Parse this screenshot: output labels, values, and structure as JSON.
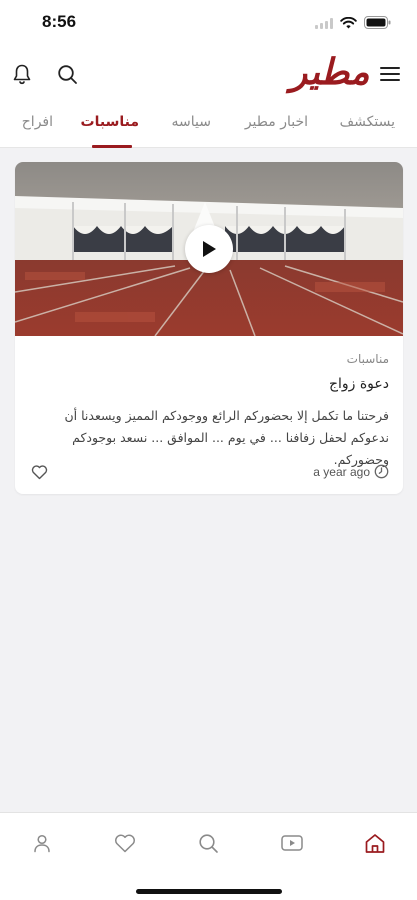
{
  "status_bar": {
    "time": "8:56"
  },
  "header": {
    "logo": "مطير"
  },
  "tabs": [
    {
      "label": "يستكشف",
      "active": false
    },
    {
      "label": "اخبار مطير",
      "active": false
    },
    {
      "label": "سياسه",
      "active": false
    },
    {
      "label": "مناسبات",
      "active": true
    },
    {
      "label": "افراح",
      "active": false
    }
  ],
  "article": {
    "category": "مناسبات",
    "title": "دعوة زواج",
    "excerpt": "فرحتنا ما تكمل إلا بحضوركم الرائع ووجودكم المميز ويسعدنا أن ندعوكم لحفل زفافنا ... في يوم ... الموافق ... نسعد بوجودكم وحضوركم.",
    "time_ago": "a year ago",
    "has_video": true
  },
  "icons": {
    "header_left": [
      "bell-icon",
      "search-icon"
    ],
    "header_right": "hamburger-menu-icon",
    "bottom_nav": [
      "profile-icon",
      "favorites-icon",
      "search-icon",
      "video-icon",
      "home-icon"
    ],
    "active_bottom_nav": "home-icon"
  },
  "colors": {
    "brand": "#9a1b1f",
    "inactive": "#8a8a8a",
    "background": "#f2f2f4"
  }
}
